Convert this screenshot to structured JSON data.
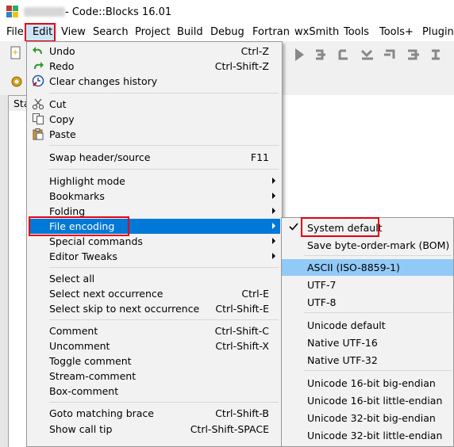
{
  "window": {
    "title": "- Code::Blocks 16.01"
  },
  "menubar": [
    "File",
    "Edit",
    "View",
    "Search",
    "Project",
    "Build",
    "Debug",
    "Fortran",
    "wxSmith",
    "Tools",
    "Tools+",
    "Plugins"
  ],
  "tab": {
    "label": "Sta"
  },
  "edit_menu": [
    {
      "label": "Undo",
      "shortcut": "Ctrl-Z",
      "icon": "undo-icon"
    },
    {
      "label": "Redo",
      "shortcut": "Ctrl-Shift-Z",
      "icon": "redo-icon"
    },
    {
      "label": "Clear changes history",
      "shortcut": "",
      "icon": "clear-history-icon"
    },
    {
      "label": "Cut",
      "shortcut": "",
      "icon": "cut-icon"
    },
    {
      "label": "Copy",
      "shortcut": "",
      "icon": "copy-icon"
    },
    {
      "label": "Paste",
      "shortcut": "",
      "icon": "paste-icon"
    },
    {
      "label": "Swap header/source",
      "shortcut": "F11"
    },
    {
      "label": "Highlight mode",
      "shortcut": "",
      "submenu": true
    },
    {
      "label": "Bookmarks",
      "shortcut": "",
      "submenu": true
    },
    {
      "label": "Folding",
      "shortcut": "",
      "submenu": true
    },
    {
      "label": "File encoding",
      "shortcut": "",
      "submenu": true,
      "highlighted": true
    },
    {
      "label": "Special commands",
      "shortcut": "",
      "submenu": true
    },
    {
      "label": "Editor Tweaks",
      "shortcut": "",
      "submenu": true
    },
    {
      "label": "Select all",
      "shortcut": ""
    },
    {
      "label": "Select next occurrence",
      "shortcut": "Ctrl-E"
    },
    {
      "label": "Select skip to next occurrence",
      "shortcut": "Ctrl-Shift-E"
    },
    {
      "label": "Comment",
      "shortcut": "Ctrl-Shift-C"
    },
    {
      "label": "Uncomment",
      "shortcut": "Ctrl-Shift-X"
    },
    {
      "label": "Toggle comment",
      "shortcut": ""
    },
    {
      "label": "Stream-comment",
      "shortcut": ""
    },
    {
      "label": "Box-comment",
      "shortcut": ""
    },
    {
      "label": "Goto matching brace",
      "shortcut": "Ctrl-Shift-B"
    },
    {
      "label": "Show call tip",
      "shortcut": "Ctrl-Shift-SPACE"
    }
  ],
  "encoding_menu": [
    {
      "label": "System default",
      "checked": true
    },
    {
      "label": "Save byte-order-mark (BOM)"
    },
    {
      "label": "ASCII (ISO-8859-1)",
      "selected": true
    },
    {
      "label": "UTF-7"
    },
    {
      "label": "UTF-8"
    },
    {
      "label": "Unicode default"
    },
    {
      "label": "Native UTF-16"
    },
    {
      "label": "Native UTF-32"
    },
    {
      "label": "Unicode 16-bit big-endian"
    },
    {
      "label": "Unicode 16-bit little-endian"
    },
    {
      "label": "Unicode 32-bit big-endian"
    },
    {
      "label": "Unicode 32-bit little-endian"
    }
  ],
  "colors": {
    "highlight": "#0078d7",
    "selection_light": "#91c9f7",
    "annotation_red": "#e5000e"
  }
}
